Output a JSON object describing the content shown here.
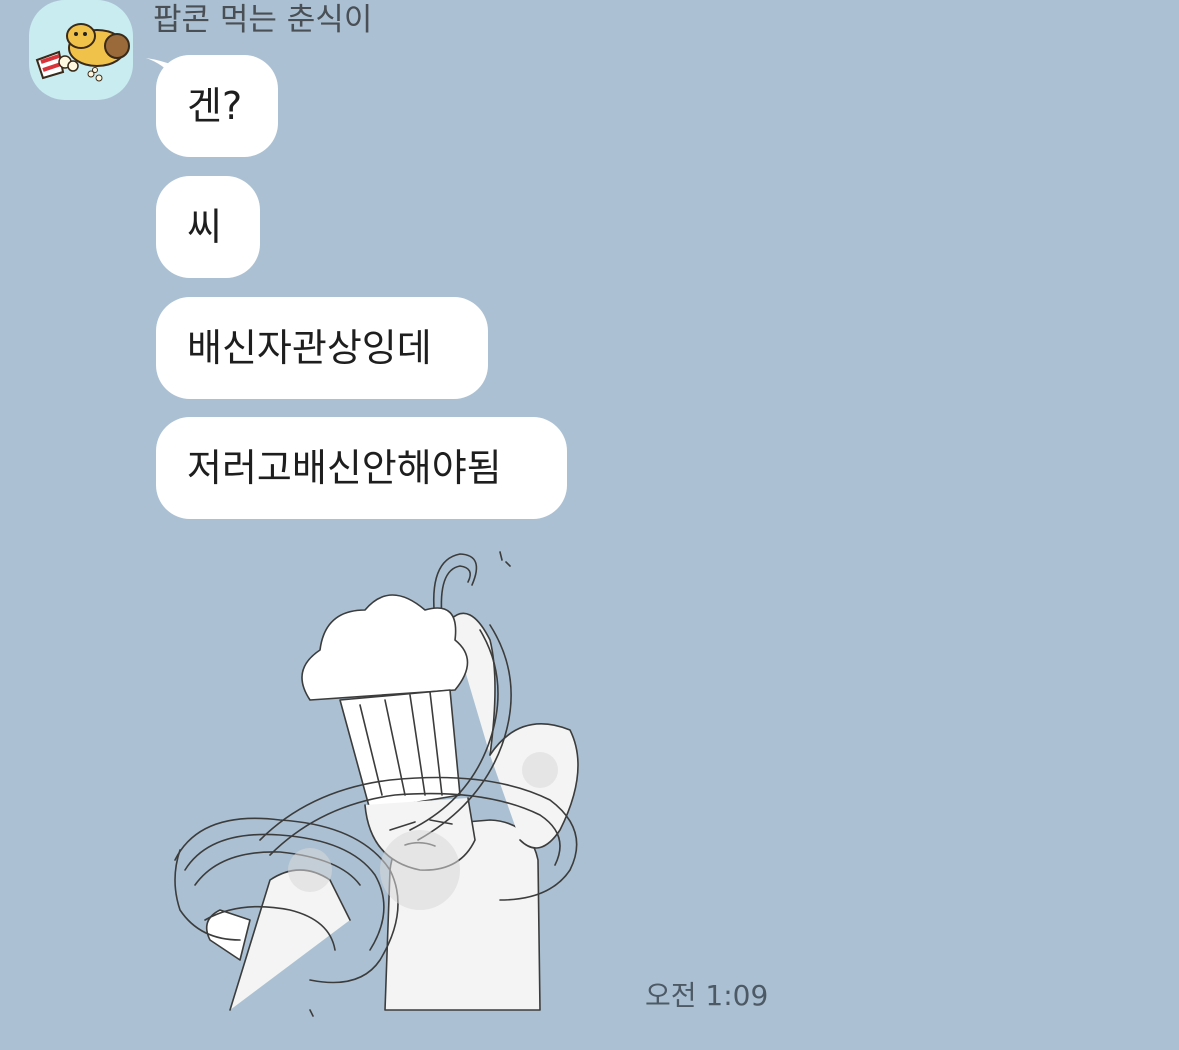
{
  "chat": {
    "sender_name": "팝콘 먹는 춘식이",
    "avatar_icon": "popcorn-character-icon",
    "messages": [
      {
        "text": "겐?"
      },
      {
        "text": "씨"
      },
      {
        "text": "배신자관상잉데"
      },
      {
        "text": "저러고배신안해야됨"
      }
    ],
    "sticker_icon": "chef-dancing-sticker",
    "timestamp": "오전 1:09"
  },
  "colors": {
    "background": "#abc1d3",
    "bubble": "#ffffff",
    "avatar_bg": "#c9ecf1"
  }
}
